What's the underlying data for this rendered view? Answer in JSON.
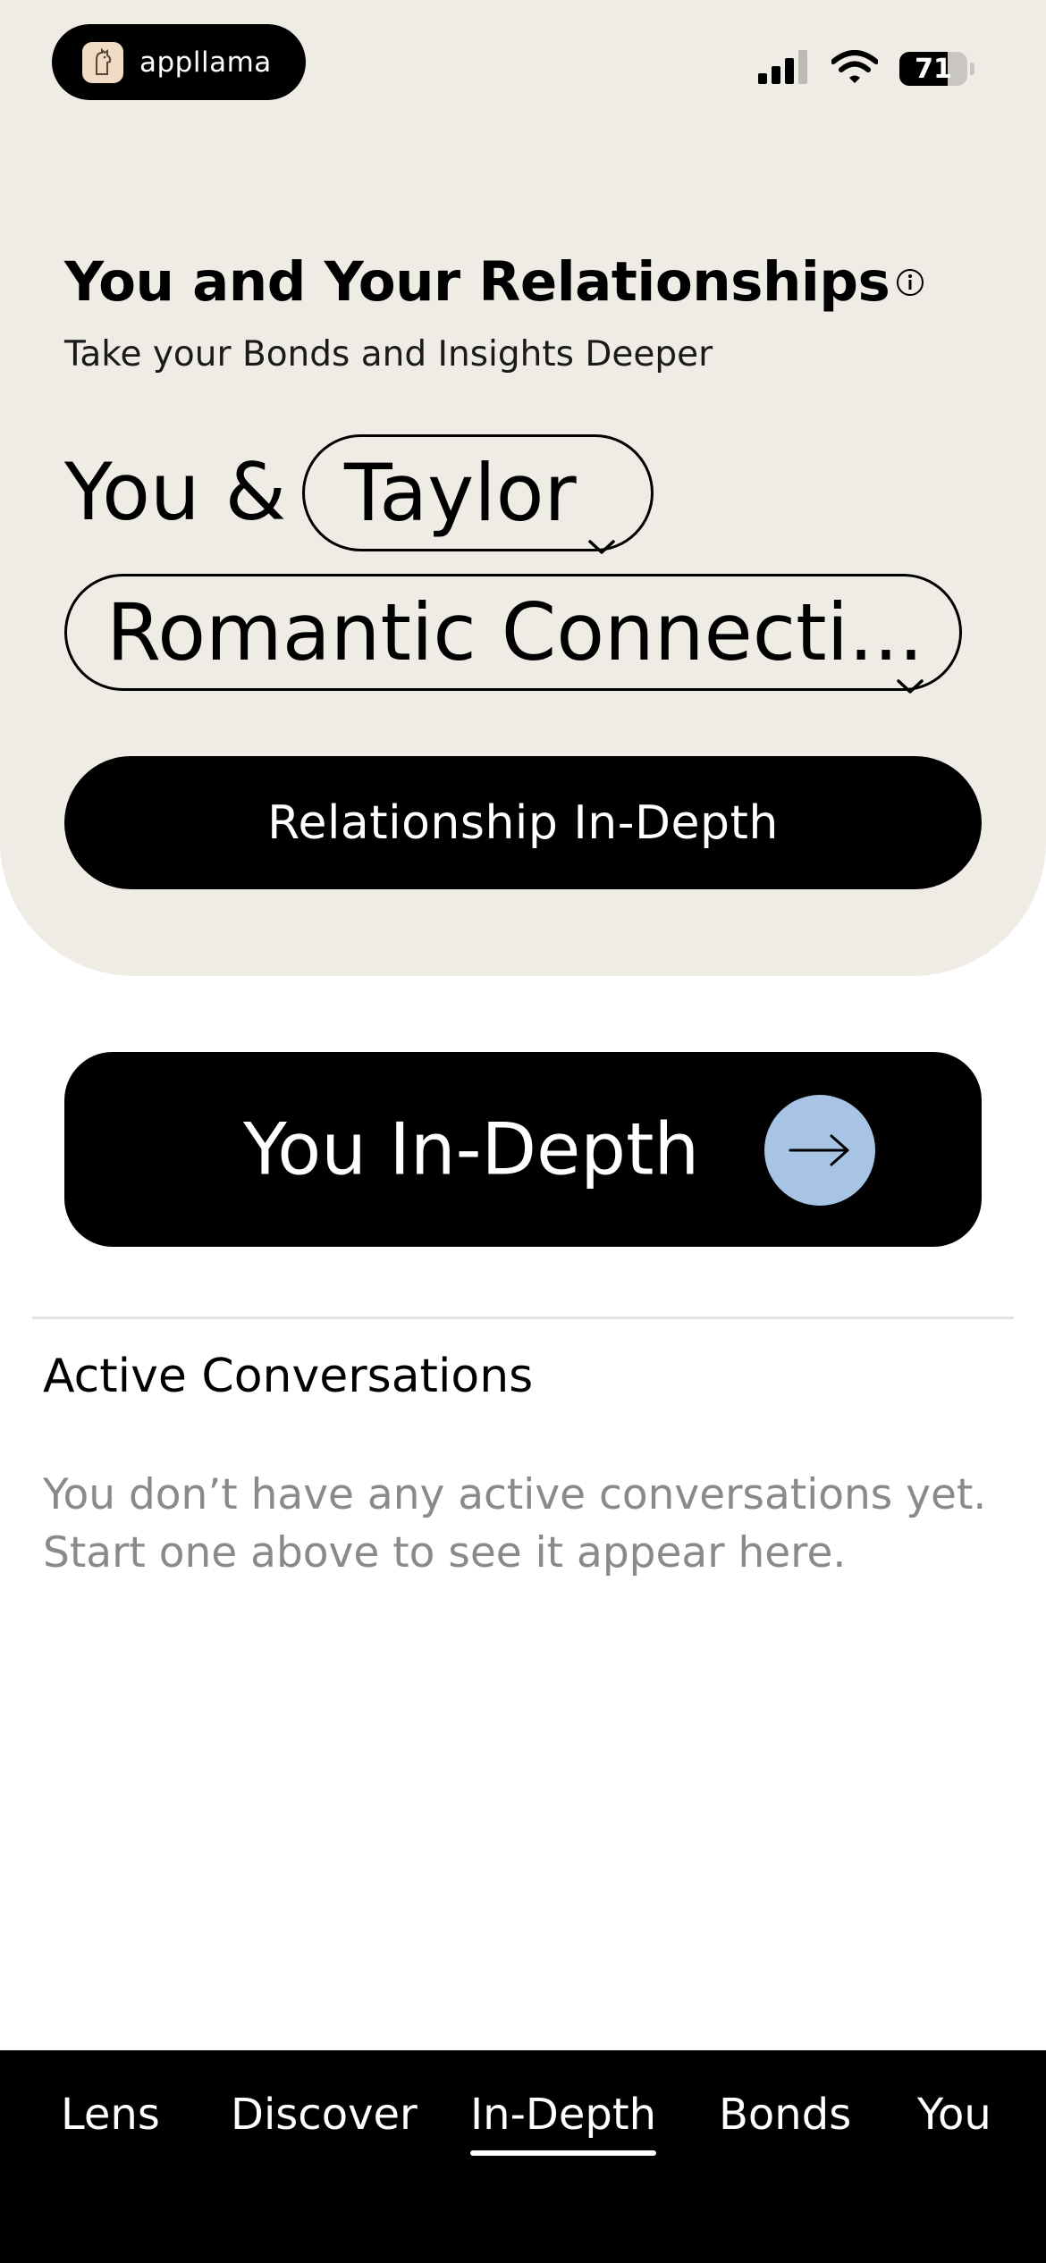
{
  "status_bar": {
    "app_name": "appllama",
    "battery_percent": "71",
    "battery_level": 0.71,
    "icons": [
      "cellular-signal-icon",
      "wifi-icon",
      "battery-icon"
    ]
  },
  "header": {
    "title": "You and Your Relationships",
    "subtitle": "Take your Bonds and Insights Deeper"
  },
  "selector": {
    "prefix": "You &",
    "person_value": "Taylor",
    "relationship_type_value": "Romantic Connecti..."
  },
  "actions": {
    "relationship_button_label": "Relationship In-Depth",
    "you_button_label": "You In-Depth"
  },
  "conversations": {
    "title": "Active Conversations",
    "empty_line1": "You don’t have any active conversations yet.",
    "empty_line2": "Start one above to see it appear here."
  },
  "bottom_nav": {
    "items": [
      {
        "label": "Lens",
        "active": false
      },
      {
        "label": "Discover",
        "active": false
      },
      {
        "label": "In-Depth",
        "active": true
      },
      {
        "label": "Bonds",
        "active": false
      },
      {
        "label": "You",
        "active": false
      }
    ]
  },
  "colors": {
    "card_background": "#efebe5",
    "arrow_accent": "#a7c4e5",
    "muted_text": "#8a8a8a"
  }
}
